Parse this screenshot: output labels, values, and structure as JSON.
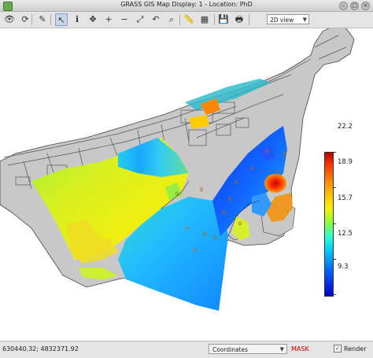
{
  "window": {
    "title": "GRASS GIS Map Display: 1  - Location: PhD",
    "controls": [
      "minimize",
      "maximize",
      "close"
    ]
  },
  "toolbar": {
    "buttons": [
      {
        "name": "display-map-icon",
        "symbol": "👁"
      },
      {
        "name": "render-map-icon",
        "symbol": "⟳"
      },
      {
        "name": "erase-display-icon",
        "symbol": "✎"
      },
      {
        "name": "pointer-icon",
        "symbol": "↖"
      },
      {
        "name": "query-icon",
        "symbol": "ℹ"
      },
      {
        "name": "pan-icon",
        "symbol": "✥"
      },
      {
        "name": "zoom-in-icon",
        "symbol": "+"
      },
      {
        "name": "zoom-out-icon",
        "symbol": "−"
      },
      {
        "name": "zoom-region-icon",
        "symbol": "⤢"
      },
      {
        "name": "zoom-back-icon",
        "symbol": "↶"
      },
      {
        "name": "zoom-menu-icon",
        "symbol": "⌕"
      },
      {
        "name": "analyze-icon",
        "symbol": "📏"
      },
      {
        "name": "overlay-icon",
        "symbol": "▦"
      },
      {
        "name": "save-icon",
        "symbol": "💾"
      },
      {
        "name": "print-icon",
        "symbol": "🖶"
      }
    ],
    "view_mode": "2D view"
  },
  "legend": {
    "ticks": [
      "22.2",
      "18.9",
      "15.7",
      "12.5",
      "9.3"
    ]
  },
  "statusbar": {
    "coordinates": "630440.32; 4832371.92",
    "mode": "Coordinates",
    "mask_label": "MASK",
    "render_label": "Render",
    "render_checked": true
  }
}
